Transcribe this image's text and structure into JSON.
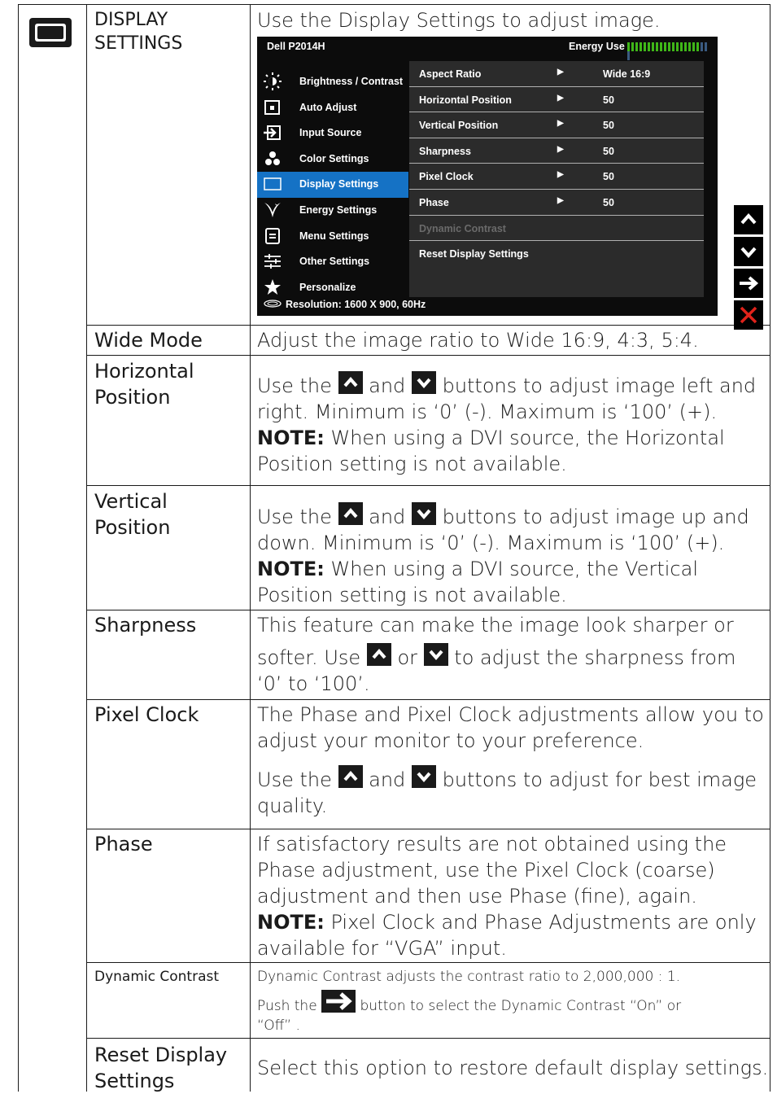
{
  "section": {
    "icon": "display-settings-icon",
    "title_line1": "DISPLAY",
    "title_line2": "SETTINGS",
    "intro": "Use the Display Settings to adjust image."
  },
  "osd": {
    "title": "Dell P2014H",
    "energy_label": "Energy Use",
    "energy_level": 0.85,
    "menu": [
      {
        "label": "Brightness / Contrast",
        "icon": "sun-icon"
      },
      {
        "label": "Auto Adjust",
        "icon": "auto-adjust-icon"
      },
      {
        "label": "Input Source",
        "icon": "input-source-icon"
      },
      {
        "label": "Color Settings",
        "icon": "color-dots-icon"
      },
      {
        "label": "Display Settings",
        "icon": "monitor-icon",
        "active": true
      },
      {
        "label": "Energy Settings",
        "icon": "leaf-icon"
      },
      {
        "label": "Menu Settings",
        "icon": "menu-doc-icon"
      },
      {
        "label": "Other Settings",
        "icon": "sliders-icon"
      },
      {
        "label": "Personalize",
        "icon": "star-icon"
      }
    ],
    "submenu": [
      {
        "label": "Aspect Ratio",
        "arrow": "▶",
        "value": "Wide 16:9"
      },
      {
        "label": "Horizontal Position",
        "arrow": "▶",
        "value": "50"
      },
      {
        "label": "Vertical Position",
        "arrow": "▶",
        "value": "50"
      },
      {
        "label": "Sharpness",
        "arrow": "▶",
        "value": "50"
      },
      {
        "label": "Pixel Clock",
        "arrow": "▶",
        "value": "50"
      },
      {
        "label": "Phase",
        "arrow": "▶",
        "value": "50"
      },
      {
        "label": "Dynamic Contrast",
        "arrow": "",
        "value": "",
        "disabled": true
      },
      {
        "label": "Reset Display Settings",
        "arrow": "",
        "value": ""
      }
    ],
    "footer": "Resolution: 1600 X 900, 60Hz",
    "side_buttons": [
      "up-chevron-icon",
      "down-chevron-icon",
      "right-arrow-icon",
      "close-x-icon"
    ],
    "accent_color": "#1572c5",
    "close_color": "#e0231b"
  },
  "rows": {
    "wide_mode": {
      "label": "Wide Mode",
      "desc": "Adjust the image ratio to Wide 16:9, 4:3, 5:4."
    },
    "horizontal": {
      "label1": "Horizontal",
      "label2": "Position",
      "p1a": "Use the",
      "p1b": "and",
      "p1c": "buttons to adjust image left and",
      "p2": "right. Minimum is ‘0’ (-). Maximum is ‘100’ (+).",
      "note": "NOTE:",
      "p3": " When using a DVI source, the Horizontal",
      "p4": "Position setting is not available."
    },
    "vertical": {
      "label1": "Vertical",
      "label2": "Position",
      "p1a": "Use the",
      "p1b": "and",
      "p1c": "buttons to adjust image up and",
      "p2": "down. Minimum is ‘0’ (-). Maximum is ‘100’ (+).",
      "note": "NOTE:",
      "p3": " When using a DVI source, the Vertical",
      "p4": "Position setting is not available."
    },
    "sharpness": {
      "label": "Sharpness",
      "p1": "This feature can make the image look sharper or",
      "p2a": "softer. Use",
      "p2b": "or",
      "p2c": "to adjust the sharpness from",
      "p3": "‘0’ to ‘100’."
    },
    "pixel_clock": {
      "label": "Pixel Clock",
      "p1": "The Phase and Pixel Clock adjustments allow you to",
      "p2": "adjust your monitor to your preference.",
      "p3a": "Use the",
      "p3b": "and",
      "p3c": "buttons to adjust for best image",
      "p4": "quality."
    },
    "phase": {
      "label": "Phase",
      "p1": "If satisfactory results are not obtained using the",
      "p2": "Phase adjustment, use the Pixel Clock (coarse)",
      "p3": "adjustment and then use Phase (fine), again.",
      "note": "NOTE:",
      "p4": " Pixel Clock and Phase Adjustments are only",
      "p5": "available for “VGA” input."
    },
    "dynamic_contrast": {
      "label": "Dynamic Contrast",
      "p1": "Dynamic Contrast adjusts the contrast ratio to 2,000,000 : 1.",
      "p2a": "Push the",
      "p2b": "button to select the Dynamic Contrast “On” or",
      "p3": "“Off” ."
    },
    "reset": {
      "label1": "Reset Display",
      "label2": "Settings",
      "desc": "Select this option to restore default display settings."
    }
  }
}
